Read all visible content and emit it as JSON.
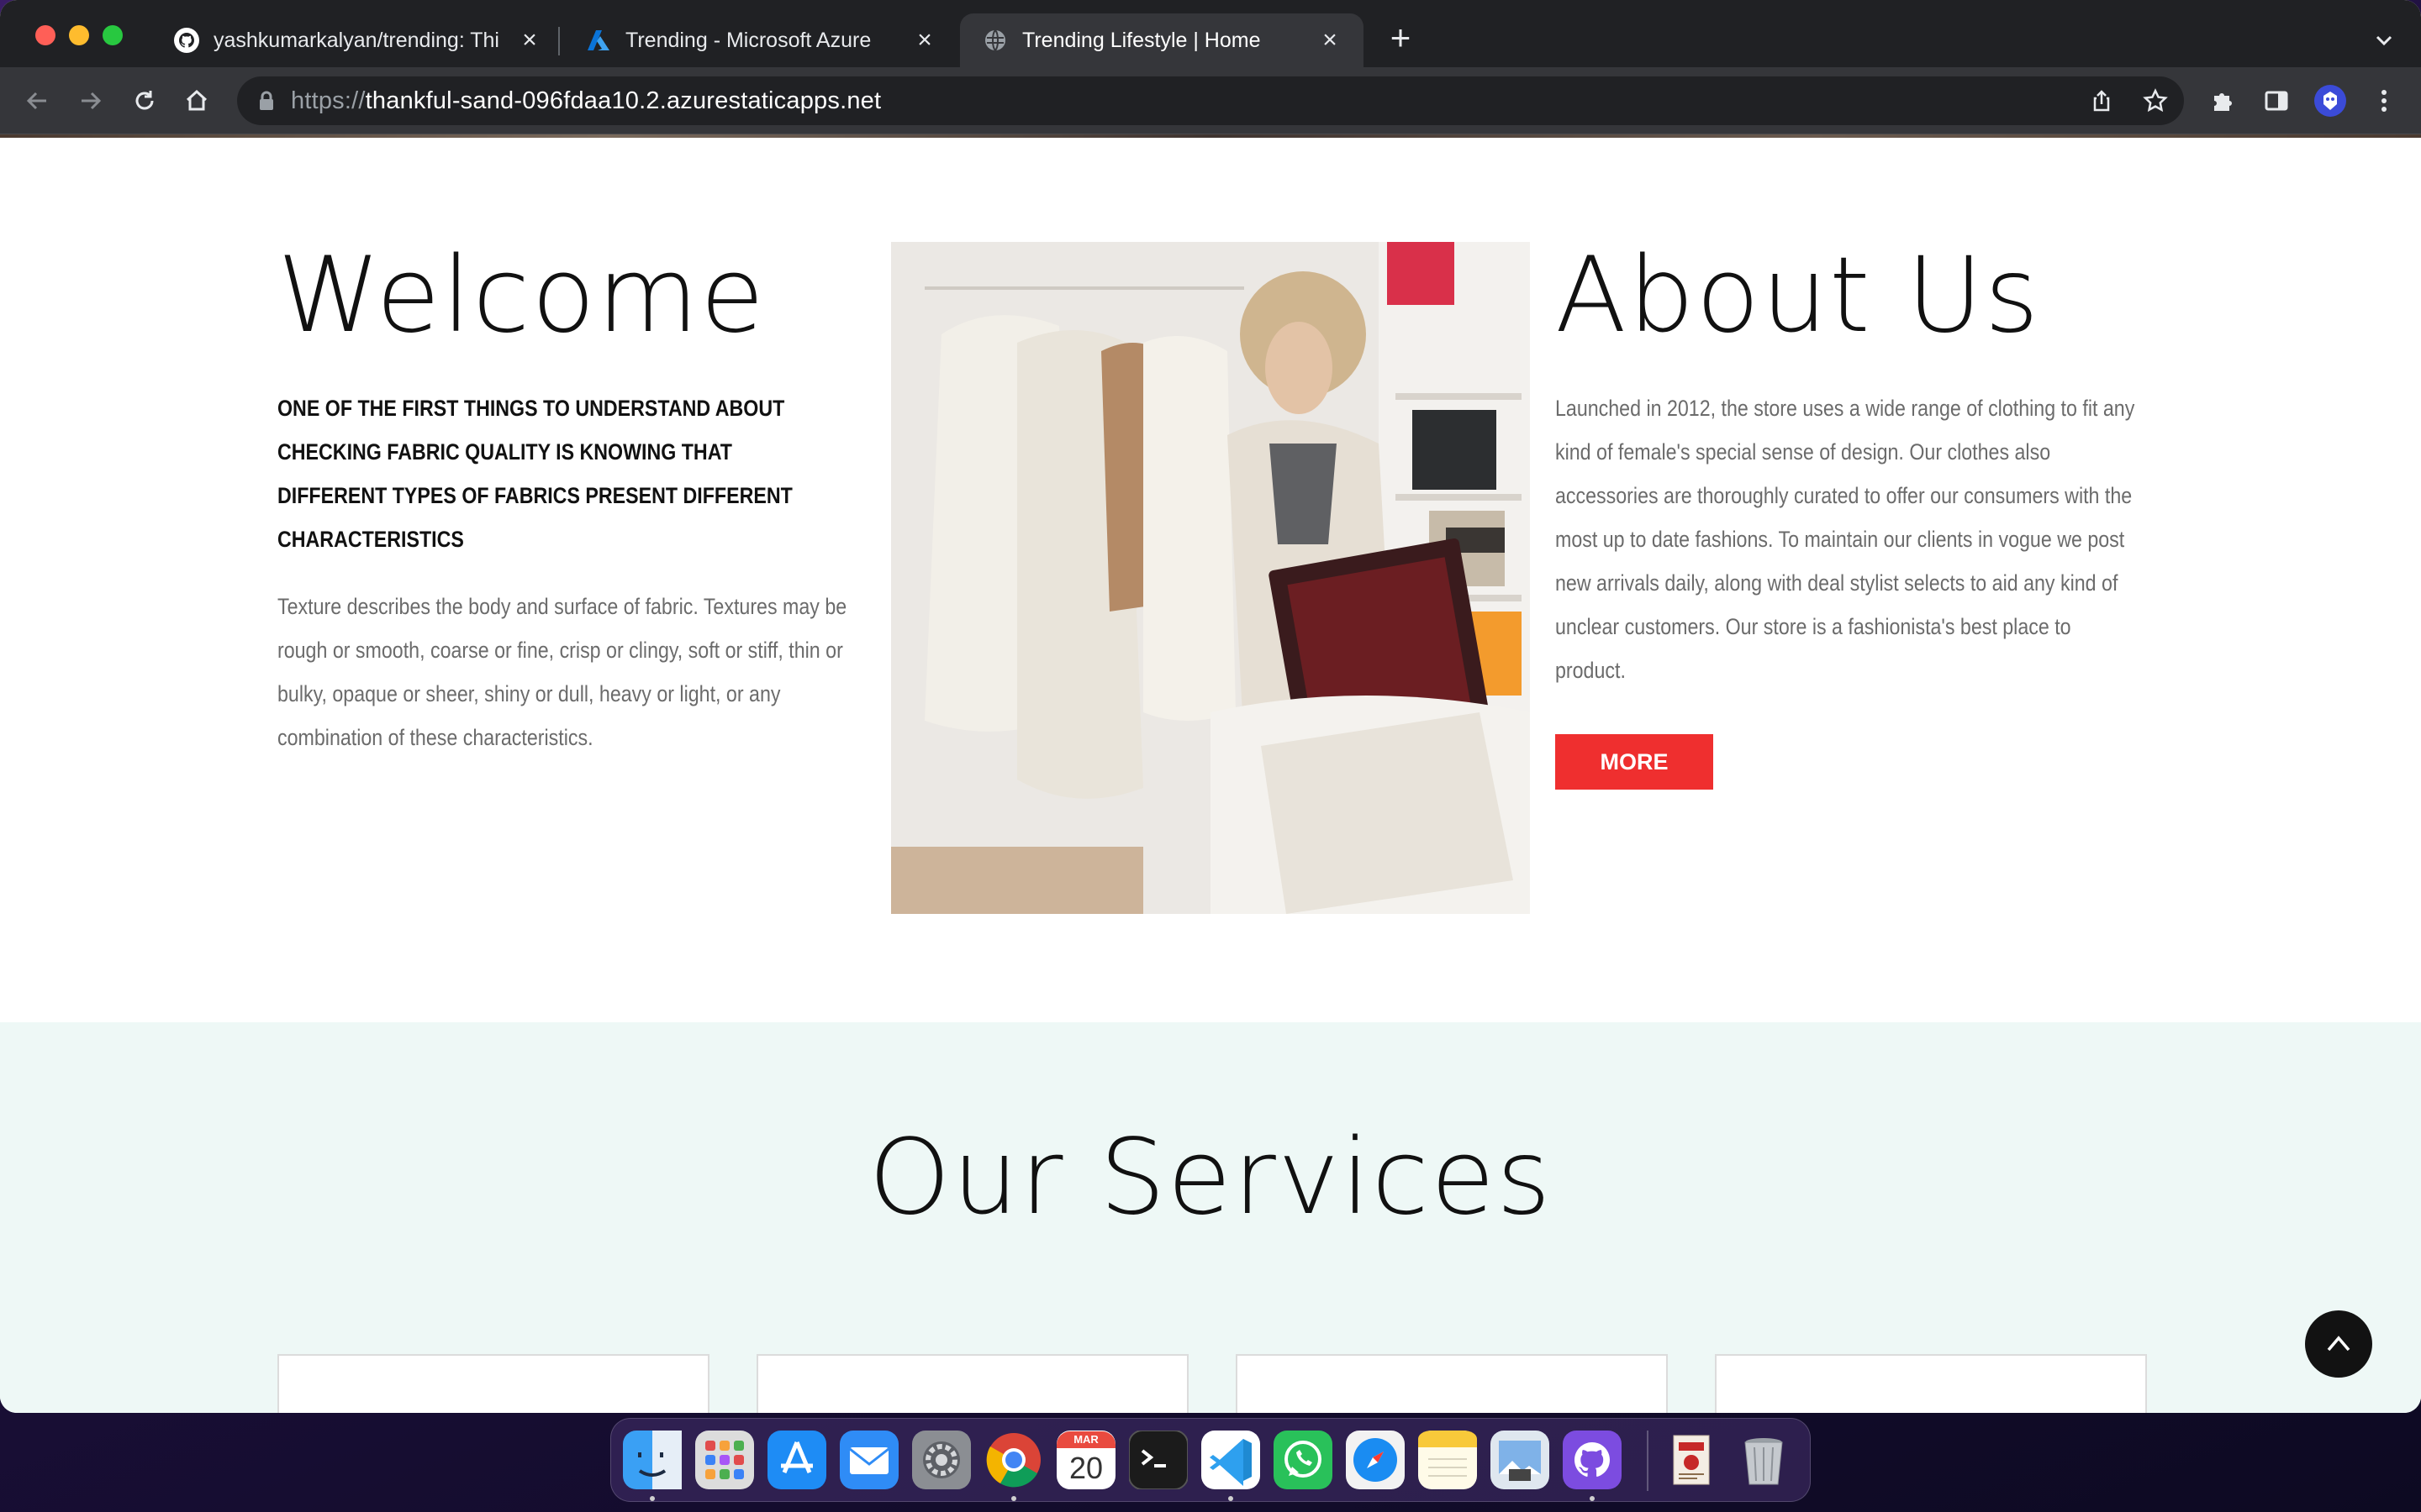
{
  "browser": {
    "tabs": [
      {
        "title": "yashkumarkalyan/trending: Thi",
        "favicon": "github-icon",
        "active": false
      },
      {
        "title": "Trending - Microsoft Azure",
        "favicon": "azure-icon",
        "active": false
      },
      {
        "title": "Trending Lifestyle | Home",
        "favicon": "globe-icon",
        "active": true
      }
    ],
    "url_scheme": "https://",
    "url_host": "thankful-sand-096fdaa10.2.azurestaticapps.net"
  },
  "welcome": {
    "title": "Welcome",
    "lead": "ONE OF THE FIRST THINGS TO UNDERSTAND ABOUT CHECKING FABRIC QUALITY IS KNOWING THAT DIFFERENT TYPES OF FABRICS PRESENT DIFFERENT CHARACTERISTICS",
    "body": "Texture describes the body and surface of fabric. Textures may be rough or smooth, coarse or fine, crisp or clingy, soft or stiff, thin or bulky, opaque or sheer, shiny or dull, heavy or light, or any combination of these characteristics."
  },
  "about": {
    "title": "About Us",
    "body": "Launched in 2012, the store uses a wide range of clothing to fit any kind of female's special sense of design. Our clothes also accessories are thoroughly curated to offer our consumers with the most up to date fashions. To maintain our clients in vogue we post new arrivals daily, along with deal stylist selects to aid any kind of unclear customers. Our store is a fashionista's best place to product.",
    "button": "MORE"
  },
  "services": {
    "title": "Our Services"
  },
  "dock": {
    "calendar_month": "MAR",
    "calendar_day": "20",
    "apps": [
      "finder-icon",
      "launchpad-icon",
      "app-store-icon",
      "mail-icon",
      "system-settings-icon",
      "chrome-icon",
      "calendar-icon",
      "terminal-icon",
      "vscode-icon",
      "whatsapp-icon",
      "safari-icon",
      "notes-icon",
      "preview-icon",
      "github-desktop-icon",
      "document-icon",
      "trash-icon"
    ]
  },
  "colors": {
    "accent": "#ef2f2f",
    "services_bg": "#eef8f6",
    "chrome_dark": "#202124"
  }
}
